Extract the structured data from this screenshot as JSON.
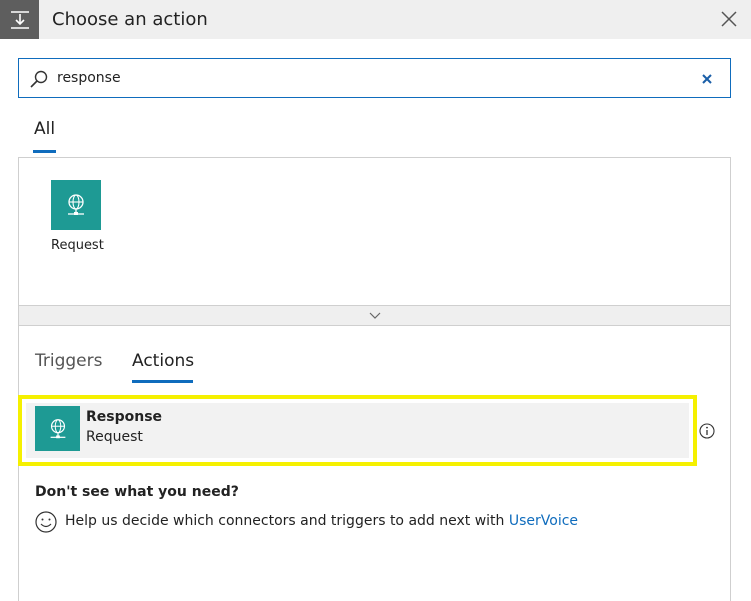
{
  "header": {
    "title": "Choose an action",
    "icon": "action-insert-icon",
    "close_icon": "close-icon"
  },
  "search": {
    "value": "response",
    "placeholder": "",
    "icon": "search-icon",
    "clear_icon": "clear-icon"
  },
  "connector_tabs": [
    {
      "label": "All",
      "selected": true
    }
  ],
  "connectors": [
    {
      "label": "Request",
      "icon": "globe-icon",
      "color": "#1e9a94"
    }
  ],
  "collapse_icon": "chevron-down-icon",
  "kind_tabs": [
    {
      "label": "Triggers",
      "selected": false
    },
    {
      "label": "Actions",
      "selected": true
    }
  ],
  "actions": [
    {
      "title": "Response",
      "subtitle": "Request",
      "icon": "globe-icon",
      "color": "#1e9a94",
      "highlight": "#f5f000"
    }
  ],
  "info_icon": "info-icon",
  "help": {
    "heading": "Don't see what you need?",
    "text": "Help us decide which connectors and triggers to add next with ",
    "link": "UserVoice",
    "icon": "smiley-icon"
  },
  "colors": {
    "accent": "#0f6cbd",
    "connector": "#1e9a94",
    "highlight": "#f5f000"
  }
}
